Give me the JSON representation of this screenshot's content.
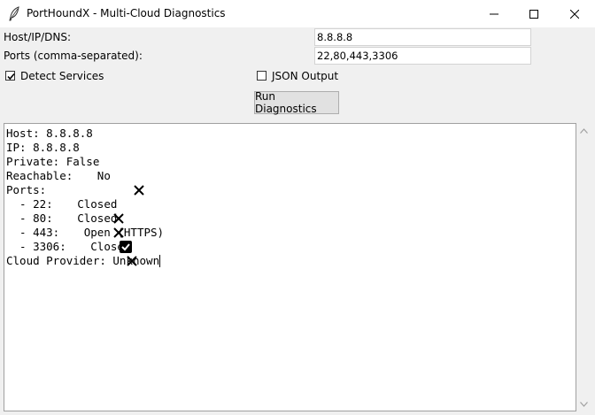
{
  "window": {
    "title": "PortHoundX - Multi-Cloud Diagnostics"
  },
  "form": {
    "host_label": "Host/IP/DNS:",
    "host_value": "8.8.8.8",
    "ports_label": "Ports (comma-separated):",
    "ports_value": "22,80,443,3306",
    "detect_services_label": "Detect Services",
    "detect_services_checked": true,
    "json_output_label": "JSON Output",
    "json_output_checked": false,
    "run_button_label": "Run Diagnostics"
  },
  "output": {
    "host_line": "Host: 8.8.8.8",
    "ip_line": "IP: 8.8.8.8",
    "private_line": "Private: False",
    "reachable_prefix": "Reachable: ",
    "reachable_value": "No",
    "ports_header": "Ports:",
    "ports": [
      {
        "prefix": "  - 22: ",
        "status": "Closed",
        "icon": "cross-icon"
      },
      {
        "prefix": "  - 80: ",
        "status": "Closed",
        "icon": "cross-icon"
      },
      {
        "prefix": "  - 443: ",
        "status": "Open (HTTPS)",
        "icon": "check-box-icon"
      },
      {
        "prefix": "  - 3306: ",
        "status": "Closed",
        "icon": "cross-icon"
      }
    ],
    "cloud_line": "Cloud Provider: Unknown"
  }
}
